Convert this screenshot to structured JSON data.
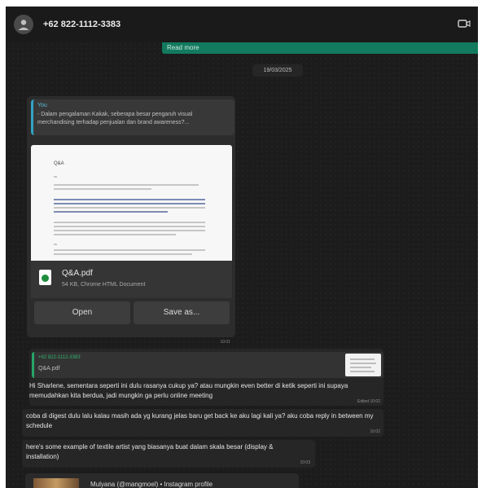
{
  "header": {
    "contact": "+62 822-1112-3383"
  },
  "top_bubble": {
    "read_more": "Read more"
  },
  "date_chip": "19/03/2025",
  "doc_message": {
    "quote_author": "You",
    "quote_text": "- Dalam pengalaman Kakak, seberapa besar pengaruh visual merchandising terhadap penjualan dan brand awareness?...",
    "preview_title": "Q&A",
    "file_name": "Q&A.pdf",
    "file_meta": "54 KB, Chrome HTML Document",
    "open_label": "Open",
    "save_label": "Save as...",
    "time": "10:01"
  },
  "reply_message": {
    "quote_author": "+62 822-1112-3383",
    "quote_file": "Q&A.pdf",
    "text": "Hi Sharlene, sementara seperti ini dulu rasanya cukup ya? atau mungkin even better di ketik seperti ini supaya memudahkan kita berdua, jadi mungkin ga perlu online meeting",
    "time": "Edited 10:02"
  },
  "message2": {
    "text": "coba di digest dulu lalu kalau masih ada yg kurang jelas baru get back ke aku lagi kali ya? aku coba reply in between my schedule",
    "time": "10:02"
  },
  "message3": {
    "text": "here's some example of textile artist yang biasanya buat dalam skala besar (display & installation)",
    "time": "10:03"
  },
  "ig_message": {
    "text": "Mulyana (@mangmoel) • Instagram profile"
  },
  "colors": {
    "accent": "#127a5e",
    "quote_border": "#33a3c4",
    "reply_border": "#27a567"
  }
}
